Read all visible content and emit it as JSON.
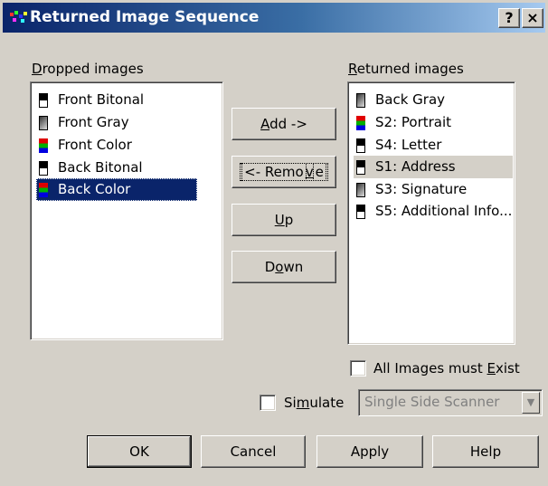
{
  "window": {
    "title": "Returned Image Sequence",
    "help_btn": "?",
    "close_btn": "×"
  },
  "dropped": {
    "label_pre": "",
    "label_u": "D",
    "label_post": "ropped images",
    "items": [
      {
        "label": "Front Bitonal",
        "icon": "bitonal"
      },
      {
        "label": "Front Gray",
        "icon": "gray"
      },
      {
        "label": "Front Color",
        "icon": "color"
      },
      {
        "label": "Back Bitonal",
        "icon": "bitonal"
      },
      {
        "label": "Back Color",
        "icon": "color",
        "selected": true
      }
    ]
  },
  "returned": {
    "label_pre": "",
    "label_u": "R",
    "label_post": "eturned images",
    "items": [
      {
        "label": "Back Gray",
        "icon": "gray"
      },
      {
        "label": "S2: Portrait",
        "icon": "color"
      },
      {
        "label": "S4: Letter",
        "icon": "bitonal"
      },
      {
        "label": "S1: Address",
        "icon": "bitonal",
        "selected": true
      },
      {
        "label": "S3: Signature",
        "icon": "gray"
      },
      {
        "label": "S5: Additional Info...",
        "icon": "bitonal"
      }
    ]
  },
  "buttons": {
    "add": {
      "pre": "",
      "u": "A",
      "post": "dd ->"
    },
    "remove": {
      "pre": "<- Remo",
      "u": "v",
      "post": "e"
    },
    "up": {
      "pre": "",
      "u": "U",
      "post": "p"
    },
    "down": {
      "pre": "D",
      "u": "o",
      "post": "wn"
    },
    "ok": "OK",
    "cancel": "Cancel",
    "apply": "Apply",
    "help": "Help"
  },
  "options": {
    "all_exist": {
      "pre": "All Images must ",
      "u": "E",
      "post": "xist",
      "checked": false
    },
    "simulate": {
      "pre": "Si",
      "u": "m",
      "post": "ulate",
      "checked": false
    },
    "scanner_select": {
      "value": "Single Side Scanner",
      "arrow": "▼"
    }
  }
}
